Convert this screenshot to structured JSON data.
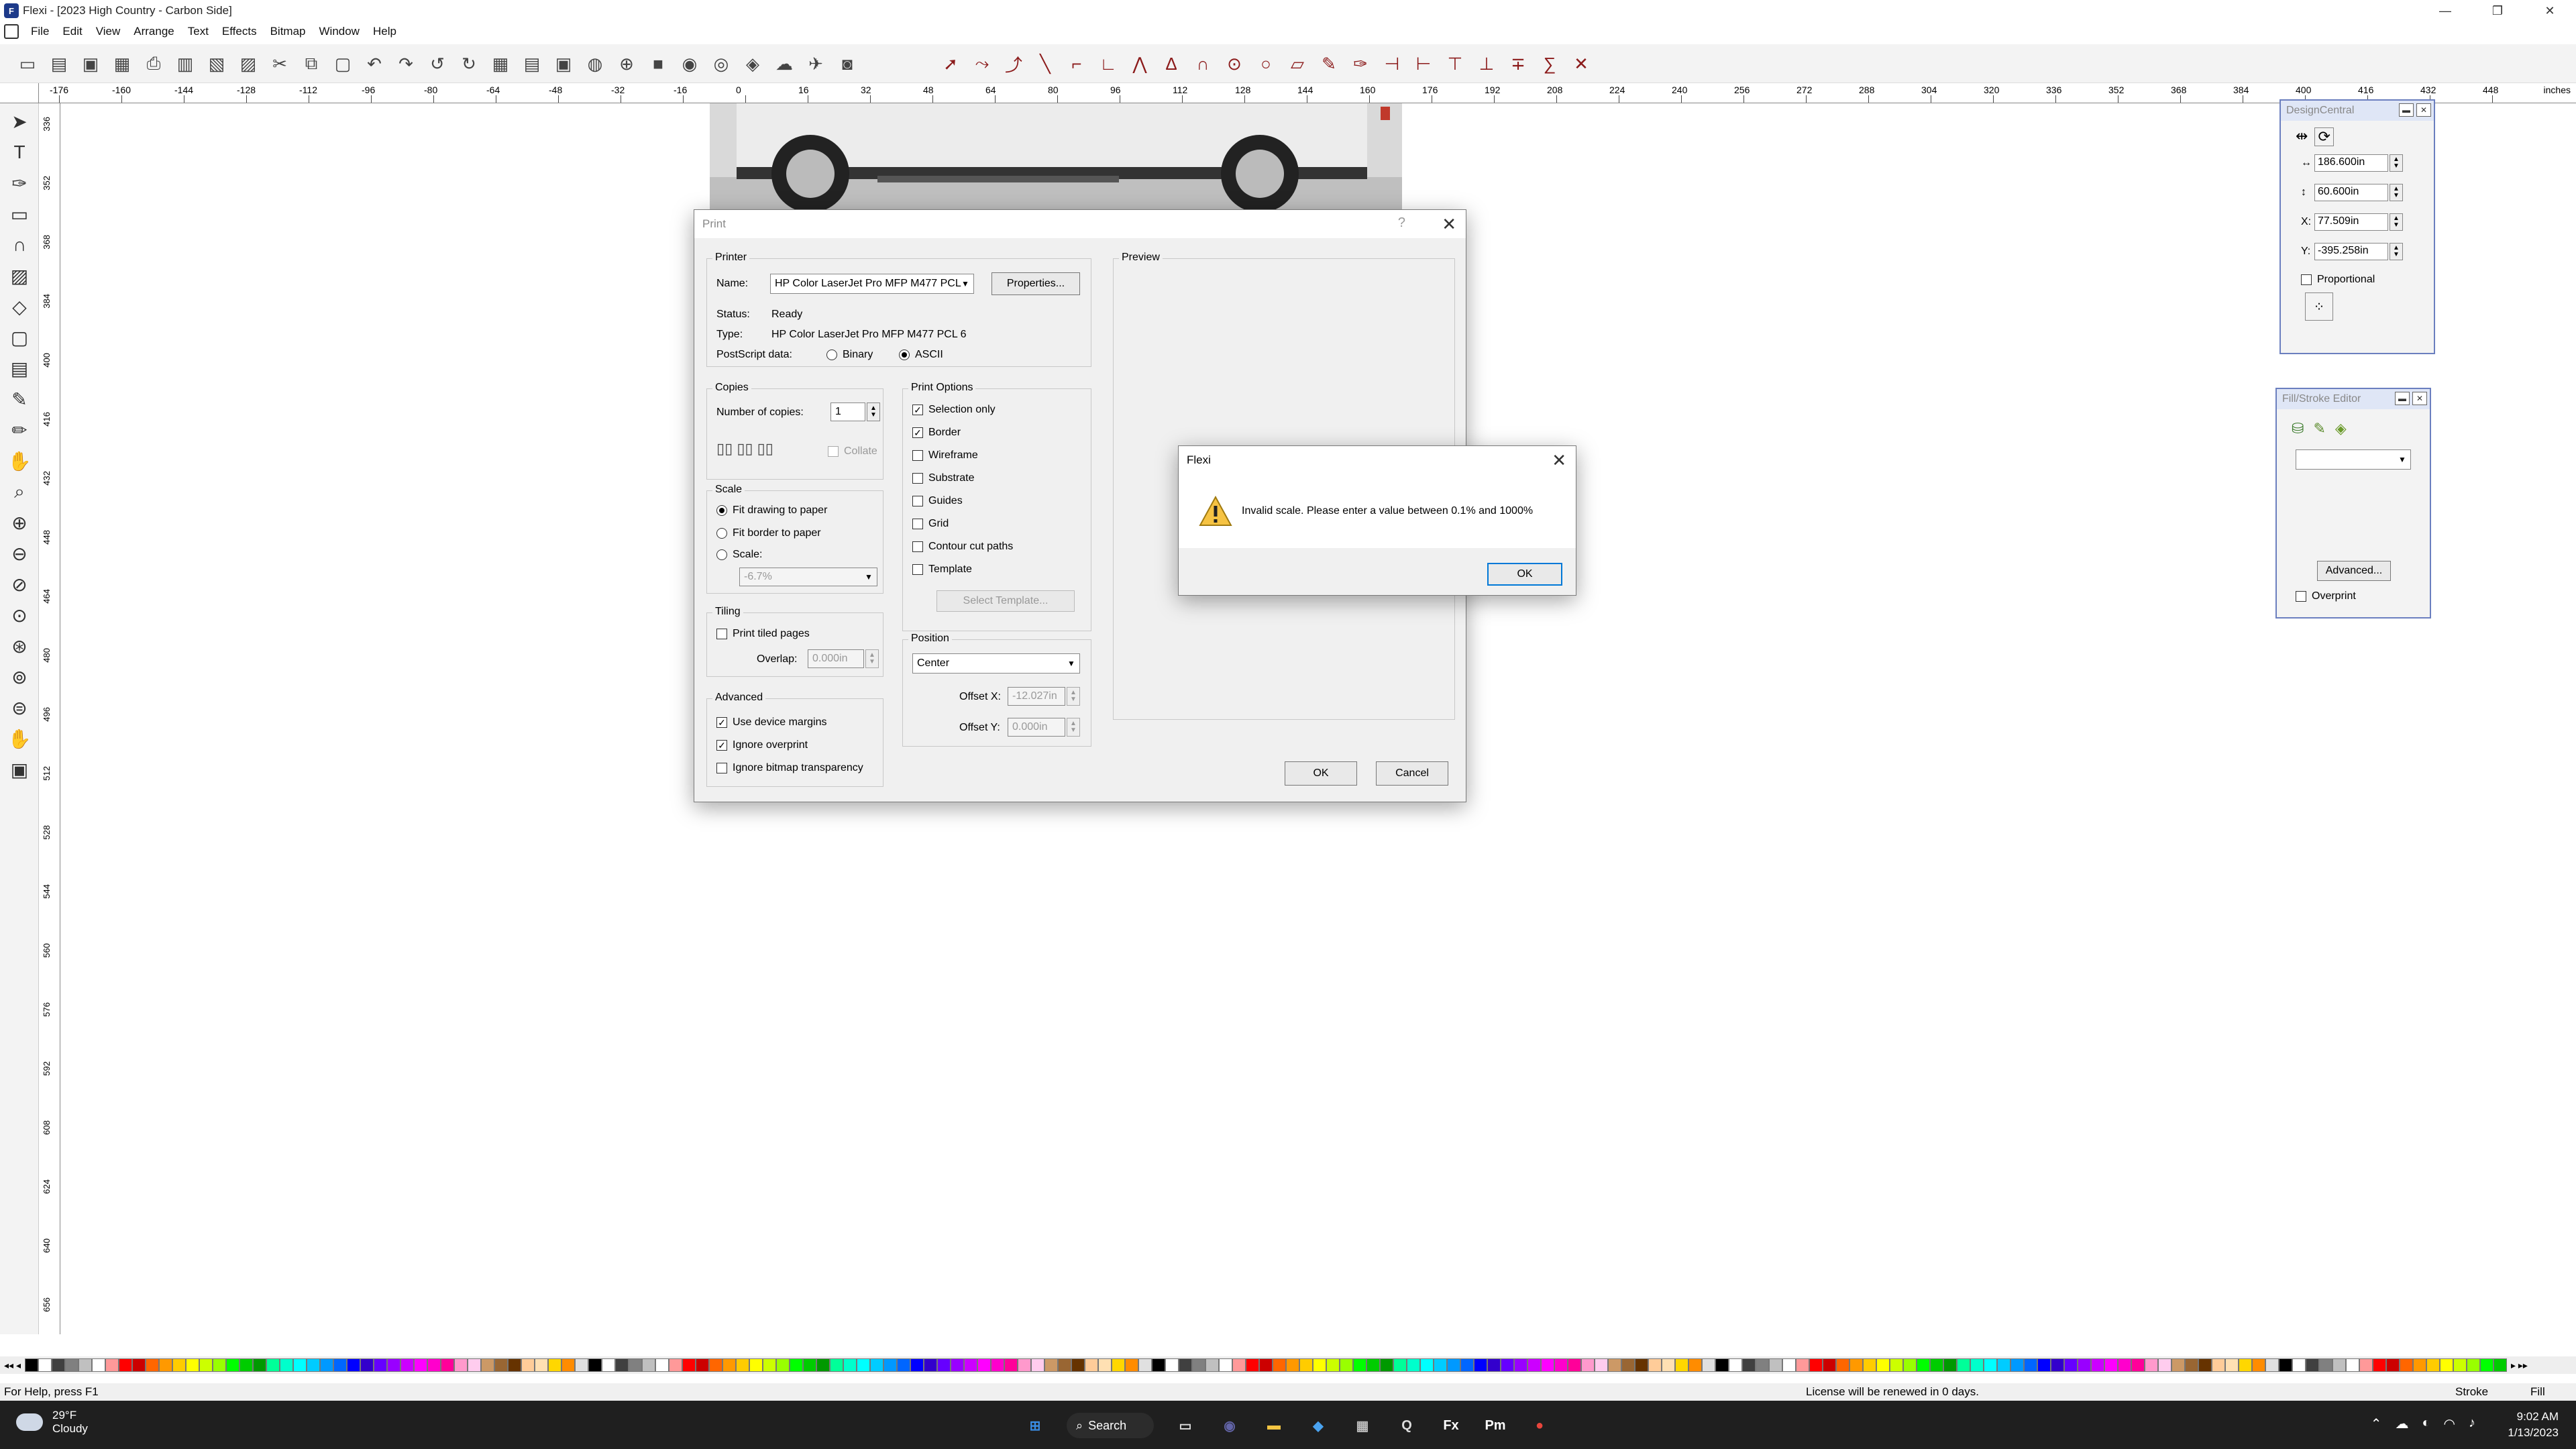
{
  "window": {
    "title": "Flexi - [2023 High Country - Carbon Side]",
    "app_icon_letter": "F",
    "buttons": [
      "—",
      "❐",
      "✕"
    ]
  },
  "menu": [
    "File",
    "Edit",
    "View",
    "Arrange",
    "Text",
    "Effects",
    "Bitmap",
    "Window",
    "Help"
  ],
  "ruler": {
    "unit_label": "inches",
    "top_ticks": [
      "-176",
      "-160",
      "-144",
      "-128",
      "-112",
      "-96",
      "-80",
      "-64",
      "-48",
      "-32",
      "-16",
      "0",
      "16",
      "32",
      "48",
      "64",
      "80",
      "96",
      "112",
      "128",
      "144",
      "160",
      "176",
      "192",
      "208",
      "224",
      "240",
      "256",
      "272",
      "288",
      "304",
      "320",
      "336",
      "352",
      "368",
      "384",
      "400",
      "416",
      "432",
      "448"
    ],
    "left_ticks": [
      "336",
      "352",
      "368",
      "384",
      "400",
      "416",
      "432",
      "448",
      "464",
      "480",
      "496",
      "512",
      "528",
      "544",
      "560",
      "576",
      "592",
      "608",
      "624",
      "640",
      "656"
    ]
  },
  "print_dialog": {
    "title": "Print",
    "help_glyph": "?",
    "close_glyph": "✕",
    "printer": {
      "group_label": "Printer",
      "name_label": "Name:",
      "name_value": "HP Color LaserJet Pro MFP M477 PCL",
      "properties_button": "Properties...",
      "status_label": "Status:",
      "status_value": "Ready",
      "type_label": "Type:",
      "type_value": "HP Color LaserJet Pro MFP M477 PCL 6",
      "postscript_label": "PostScript data:",
      "binary_label": "Binary",
      "ascii_label": "ASCII",
      "selected": "ASCII"
    },
    "copies": {
      "group_label": "Copies",
      "number_label": "Number of copies:",
      "number_value": "1",
      "collate_label": "Collate",
      "collate_checked": false
    },
    "scale": {
      "group_label": "Scale",
      "fit_drawing": "Fit drawing to paper",
      "fit_border": "Fit border to paper",
      "scale_label": "Scale:",
      "scale_value": "-6.7%",
      "selected": "fit_drawing"
    },
    "tiling": {
      "group_label": "Tiling",
      "print_tiled": "Print tiled pages",
      "print_tiled_checked": false,
      "overlap_label": "Overlap:",
      "overlap_value": "0.000in"
    },
    "advanced": {
      "group_label": "Advanced",
      "use_device_margins": "Use device margins",
      "use_device_margins_checked": true,
      "ignore_overprint": "Ignore overprint",
      "ignore_overprint_checked": true,
      "ignore_bitmap_transparency": "Ignore bitmap transparency",
      "ignore_bitmap_transparency_checked": false
    },
    "print_options": {
      "group_label": "Print Options",
      "items": [
        {
          "label": "Selection only",
          "checked": true
        },
        {
          "label": "Border",
          "checked": true
        },
        {
          "label": "Wireframe",
          "checked": false
        },
        {
          "label": "Substrate",
          "checked": false
        },
        {
          "label": "Guides",
          "checked": false
        },
        {
          "label": "Grid",
          "checked": false
        },
        {
          "label": "Contour cut paths",
          "checked": false
        },
        {
          "label": "Template",
          "checked": false
        }
      ],
      "select_template_button": "Select Template..."
    },
    "position": {
      "group_label": "Position",
      "value": "Center",
      "offset_x_label": "Offset X:",
      "offset_x_value": "-12.027in",
      "offset_y_label": "Offset Y:",
      "offset_y_value": "0.000in"
    },
    "preview_label": "Preview",
    "ok_button": "OK",
    "cancel_button": "Cancel"
  },
  "alert": {
    "title": "Flexi",
    "close_glyph": "✕",
    "message": "Invalid scale. Please enter a value between 0.1% and 1000%",
    "ok_button": "OK"
  },
  "design_central": {
    "title": "DesignCentral",
    "width_value": "186.600in",
    "height_value": "60.600in",
    "x_label": "X:",
    "x_value": "77.509in",
    "y_label": "Y:",
    "y_value": "-395.258in",
    "proportional_label": "Proportional",
    "proportional_checked": false
  },
  "fill_stroke_editor": {
    "title": "Fill/Stroke Editor",
    "advanced_button": "Advanced...",
    "overprint_label": "Overprint",
    "overprint_checked": false
  },
  "status_bar": {
    "help_text": "For Help, press F1",
    "license_text": "License will be renewed in 0 days.",
    "stroke_label": "Stroke",
    "fill_label": "Fill"
  },
  "taskbar": {
    "temperature": "29°F",
    "condition": "Cloudy",
    "search_label": "Search",
    "time": "9:02 AM",
    "date": "1/13/2023",
    "apps": [
      {
        "name": "windows-start",
        "glyph": "⊞",
        "color": "#3a8ee6"
      },
      {
        "name": "task-view",
        "glyph": "▭",
        "color": "#ddd"
      },
      {
        "name": "teams",
        "glyph": "◉",
        "color": "#6264a7"
      },
      {
        "name": "file-explorer",
        "glyph": "▬",
        "color": "#f4c542"
      },
      {
        "name": "store",
        "glyph": "◆",
        "color": "#4aa3f0"
      },
      {
        "name": "calculator",
        "glyph": "▦",
        "color": "#bbb"
      },
      {
        "name": "search-app",
        "glyph": "Q",
        "color": "#ddd"
      },
      {
        "name": "flexi",
        "glyph": "Fx",
        "color": "#fff"
      },
      {
        "name": "production-manager",
        "glyph": "Pm",
        "color": "#fff"
      },
      {
        "name": "chrome",
        "glyph": "●",
        "color": "#e8453c"
      }
    ]
  },
  "palette_colors": [
    "#000000",
    "#ffffff",
    "#404040",
    "#808080",
    "#c0c0c0",
    "#ffffff",
    "#ff9999",
    "#ff0000",
    "#cc0000",
    "#ff6600",
    "#ff9900",
    "#ffcc00",
    "#ffff00",
    "#ccff00",
    "#99ff00",
    "#00ff00",
    "#00cc00",
    "#009900",
    "#00ff99",
    "#00ffcc",
    "#00ffff",
    "#00ccff",
    "#0099ff",
    "#0066ff",
    "#0000ff",
    "#3300cc",
    "#6600ff",
    "#9900ff",
    "#cc00ff",
    "#ff00ff",
    "#ff00cc",
    "#ff0099",
    "#ff99cc",
    "#ffccee",
    "#cc9966",
    "#996633",
    "#663300",
    "#ffcc99",
    "#ffe0b3",
    "#ffd700",
    "#ff8c00",
    "#e0e0e0"
  ]
}
